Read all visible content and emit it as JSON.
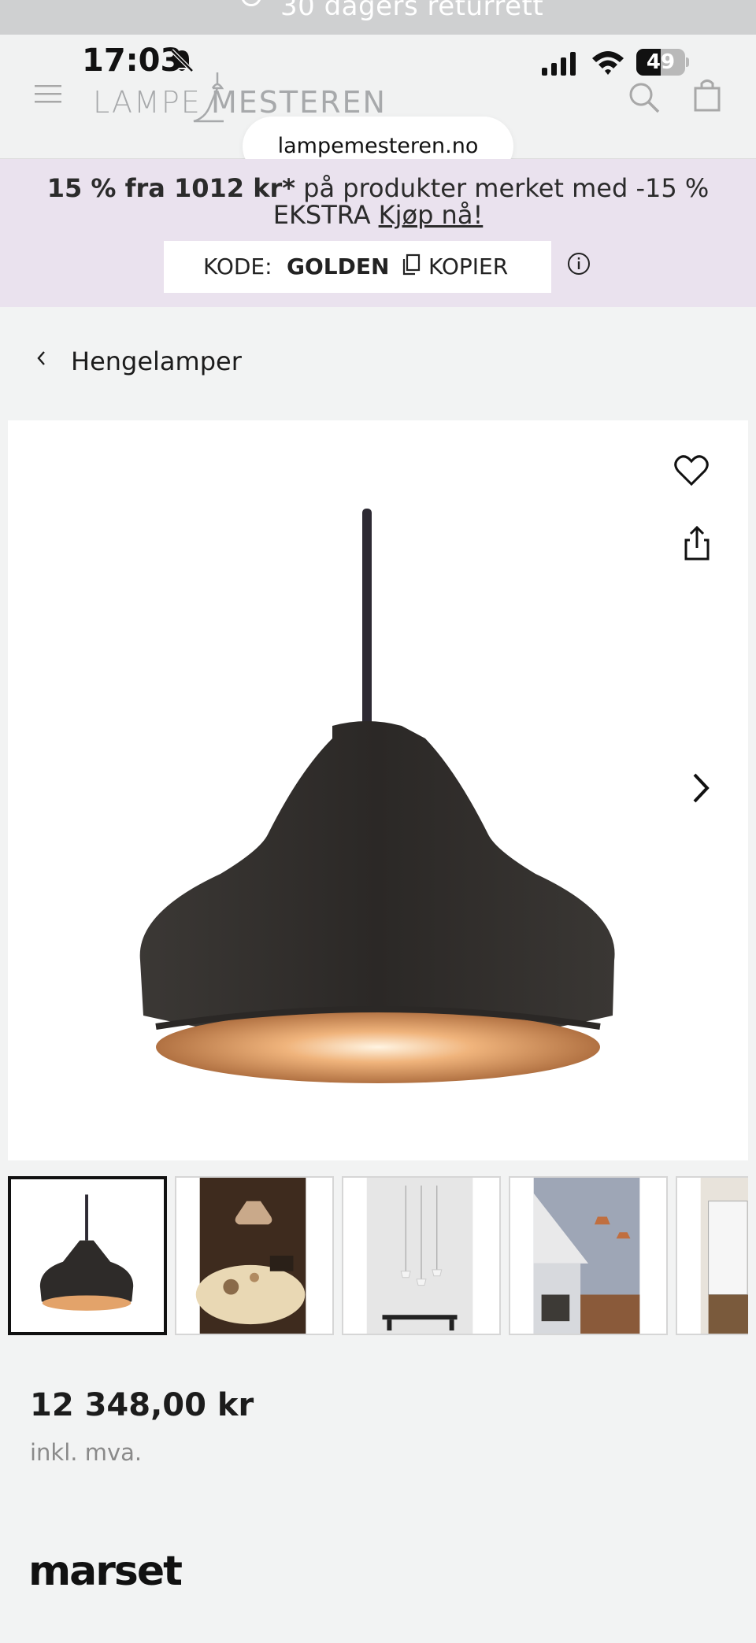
{
  "returns_strip": {
    "text": "30 dagers returrett"
  },
  "status_bar": {
    "time": "17:03",
    "battery": "49"
  },
  "header": {
    "logo_left": "LAMPE",
    "logo_right": "MESTEREN",
    "url": "lampemesteren.no"
  },
  "promo": {
    "bold_part": "15 % fra 1012 kr*",
    "rest_part": " på produkter merket med -15 %",
    "line2": "EKSTRA",
    "buy_link": "Kjøp nå!",
    "code_label": "KODE:",
    "code_value": "GOLDEN",
    "copy_label": "KOPIER"
  },
  "breadcrumb": {
    "label": "Hengelamper"
  },
  "product": {
    "price": "12 348,00 kr",
    "vat": "inkl. mva.",
    "brand": "marset"
  },
  "colors": {
    "promo_bg": "#eae2ee",
    "page_bg": "#f2f3f3",
    "lamp_shade": "#2f2c2a",
    "lamp_inner": "#c88552"
  }
}
